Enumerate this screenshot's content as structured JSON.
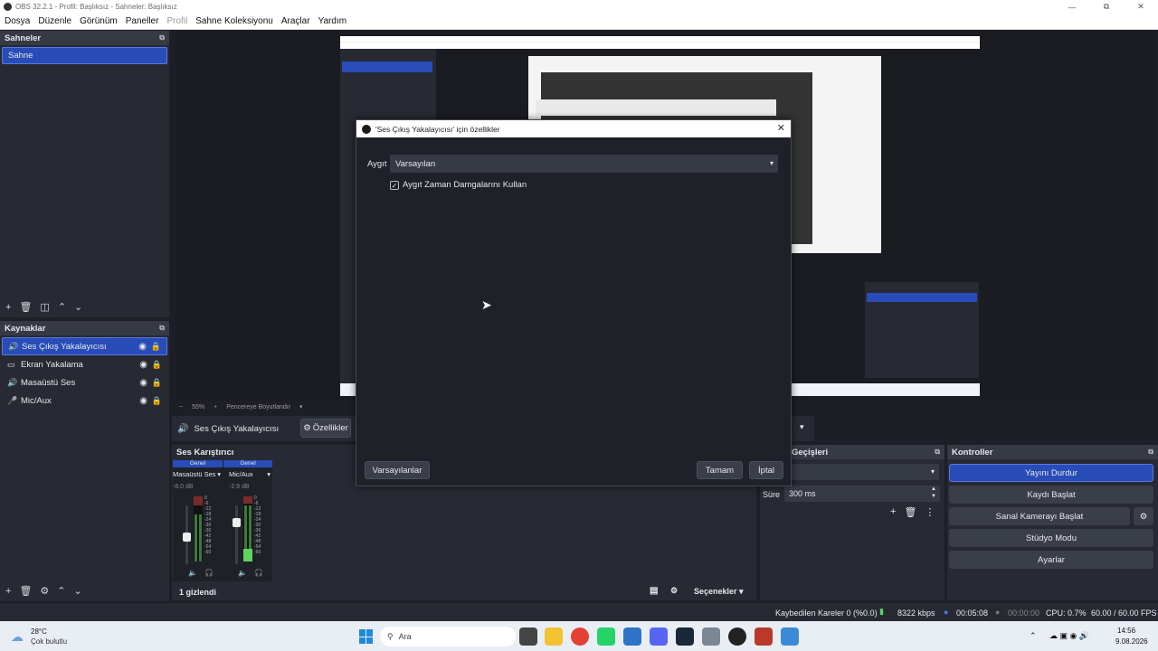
{
  "window": {
    "title": "OBS 32.2.1 - Profil: Başlıksız - Sahneler: Başlıksız"
  },
  "menu": [
    "Dosya",
    "Düzenle",
    "Görünüm",
    "Paneller",
    "Profil",
    "Sahne Koleksiyonu",
    "Araçlar",
    "Yardım"
  ],
  "scenes": {
    "title": "Sahneler",
    "items": [
      "Sahne"
    ]
  },
  "sources": {
    "title": "Kaynaklar",
    "items": [
      {
        "label": "Ses Çıkış Yakalayıcısı",
        "icon": "speaker-icon"
      },
      {
        "label": "Ekran Yakalama",
        "icon": "monitor-icon"
      },
      {
        "label": "Masaüstü Ses",
        "icon": "speaker-icon"
      },
      {
        "label": "Mic/Aux",
        "icon": "mic-icon"
      }
    ]
  },
  "preview_bar": {
    "zoom": "55%",
    "resize": "Pencereye Boyutlandır"
  },
  "context_bar": {
    "source": "Ses Çıkış Yakalayıcısı",
    "properties": "Özellikler"
  },
  "dialog": {
    "title": "'Ses Çıkış Yakalayıcısı' için özellikler",
    "device_label": "Aygıt",
    "device_value": "Varsayılan",
    "checkbox_label": "Aygıt Zaman Damgalarını Kullan",
    "checkbox_checked": true,
    "defaults_btn": "Varsayılanlar",
    "ok_btn": "Tamam",
    "cancel_btn": "İptal"
  },
  "mixer": {
    "title": "Ses Karıştırıcı",
    "channels": [
      {
        "header": "Genel",
        "name": "Masaüstü Ses",
        "db": "-8.0 dB",
        "level": 0.45
      },
      {
        "header": "Genel",
        "name": "Mic/Aux",
        "db": "-2.9 dB",
        "level": 0.75
      }
    ],
    "scale": [
      "0",
      "-6",
      "-12",
      "-18",
      "-24",
      "-30",
      "-36",
      "-42",
      "-48",
      "-54",
      "-60"
    ],
    "hidden": "1 gizlendi",
    "options": "Seçenekler"
  },
  "transitions": {
    "title": "Geçişleri",
    "duration_label": "Süre",
    "duration_value": "300 ms"
  },
  "controls": {
    "title": "Kontroller",
    "stop_stream": "Yayını Durdur",
    "start_record": "Kaydı Başlat",
    "virtual_cam": "Sanal Kamerayı Başlat",
    "studio": "Stüdyo Modu",
    "settings": "Ayarlar"
  },
  "status": {
    "dropped": "Kaybedilen Kareler 0 (%0.0)",
    "kbps": "8322 kbps",
    "stream_time": "00:05:08",
    "rec_time": "00:00:00",
    "cpu": "CPU: 0.7%",
    "fps": "60.00 / 60.00 FPS"
  },
  "taskbar": {
    "weather_temp": "28°C",
    "weather_desc": "Çok bulutlu",
    "search": "Ara",
    "time": "14:56",
    "date": "9.08.2026"
  }
}
